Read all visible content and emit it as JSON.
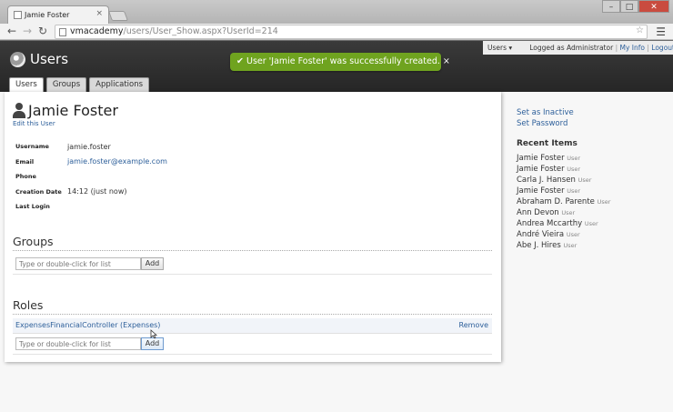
{
  "browser": {
    "tab_title": "Jamie Foster",
    "tab_close": "×",
    "url_host": "vmacademy",
    "url_path": "/users/User_Show.aspx?UserId=214",
    "window_buttons": [
      "–",
      "□",
      "✕"
    ]
  },
  "header": {
    "title": "Users",
    "userbar": {
      "menu_label": "Users ▾",
      "logged_in_text": "Logged as Administrator",
      "my_info": "My Info",
      "logout": "Logout",
      "separator": "|"
    },
    "toast": {
      "check": "✔",
      "message": "User 'Jamie Foster' was successfully created.",
      "close": "×"
    },
    "tabs": [
      {
        "label": "Users",
        "active": true
      },
      {
        "label": "Groups",
        "active": false
      },
      {
        "label": "Applications",
        "active": false
      }
    ]
  },
  "user": {
    "name": "Jamie Foster",
    "edit_link": "Edit this User",
    "details": [
      {
        "label": "Username",
        "value": "jamie.foster"
      },
      {
        "label": "Email",
        "value": "jamie.foster@example.com"
      },
      {
        "label": "Phone",
        "value": ""
      },
      {
        "label": "Creation Date",
        "value": "14:12 (just now)"
      },
      {
        "label": "Last Login",
        "value": ""
      }
    ]
  },
  "groups": {
    "title": "Groups",
    "input_placeholder": "Type or double-click for list",
    "add_label": "Add"
  },
  "roles": {
    "title": "Roles",
    "items": [
      {
        "name": "ExpensesFinancialController (Expenses)",
        "remove_label": "Remove"
      }
    ],
    "input_placeholder": "Type or double-click for list",
    "add_label": "Add"
  },
  "sidebar": {
    "actions": [
      "Set as Inactive",
      "Set Password"
    ],
    "recent_title": "Recent Items",
    "recent_items": [
      {
        "name": "Jamie Foster",
        "type": "User"
      },
      {
        "name": "Jamie Foster",
        "type": "User"
      },
      {
        "name": "Carla J. Hansen",
        "type": "User"
      },
      {
        "name": "Jamie Foster",
        "type": "User"
      },
      {
        "name": "Abraham D. Parente",
        "type": "User"
      },
      {
        "name": "Ann Devon",
        "type": "User"
      },
      {
        "name": "Andrea Mccarthy",
        "type": "User"
      },
      {
        "name": "André Vieira",
        "type": "User"
      },
      {
        "name": "Abe J. Hires",
        "type": "User"
      }
    ]
  },
  "colors": {
    "toast": "#6fa31f",
    "link": "#2d5f9a",
    "header": "#2e2e2e"
  }
}
